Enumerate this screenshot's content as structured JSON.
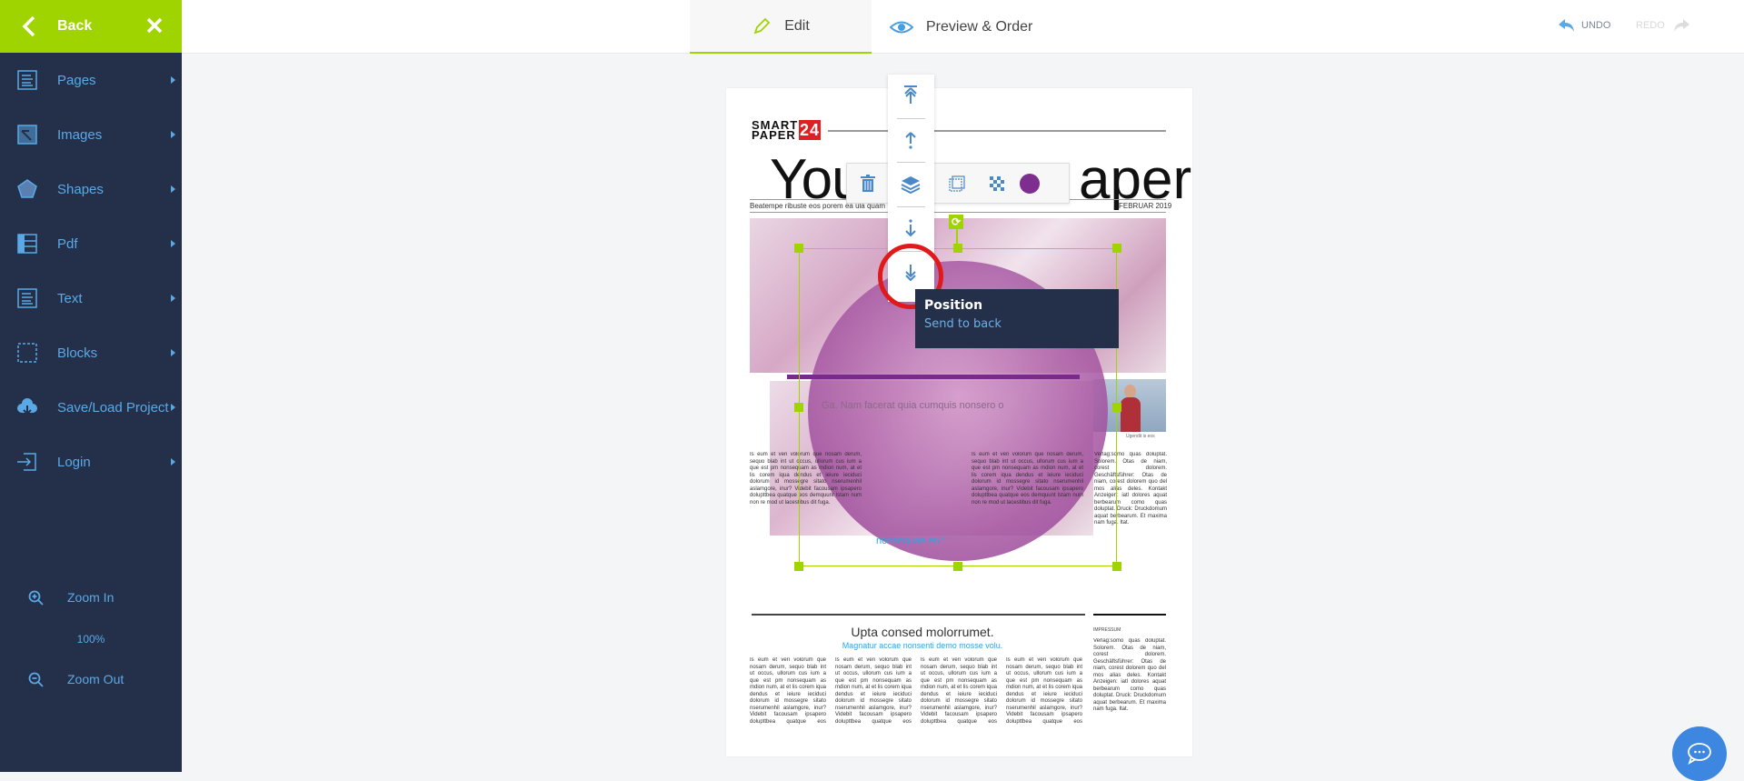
{
  "sidebar": {
    "back_label": "Back",
    "items": [
      {
        "label": "Pages",
        "icon": "pages-icon"
      },
      {
        "label": "Images",
        "icon": "images-icon"
      },
      {
        "label": "Shapes",
        "icon": "shapes-icon"
      },
      {
        "label": "Pdf",
        "icon": "pdf-icon"
      },
      {
        "label": "Text",
        "icon": "text-icon"
      },
      {
        "label": "Blocks",
        "icon": "blocks-icon"
      },
      {
        "label": "Save/Load Project",
        "icon": "cloud-download-icon"
      },
      {
        "label": "Login",
        "icon": "login-icon"
      }
    ],
    "zoom_in_label": "Zoom In",
    "zoom_level": "100%",
    "zoom_out_label": "Zoom Out"
  },
  "topbar": {
    "tabs": [
      {
        "label": "Edit",
        "active": true
      },
      {
        "label": "Preview & Order",
        "active": false
      }
    ],
    "undo_label": "UNDO",
    "redo_label": "REDO"
  },
  "document": {
    "logo_line1": "SMART",
    "logo_line2": "PAPER",
    "logo_number": "24",
    "masthead_left": "You",
    "masthead_right": "aper",
    "tagline": "Beatempe ribuste eos porem ea ula quam",
    "date": "FEBRUAR 2019",
    "feature_headline": "Ga. Nam facerat quia cumquis nonsero o",
    "quote": "nonsequae en.\"",
    "photo_caption": "Ugendit is eos",
    "headline2": "Upta consed molorrumet.",
    "subhead2": "Magnatur accae nonsenti demo mosse volu.",
    "impressum_title": "IMPRESSUM",
    "body_text": "Is eum et veri volorum que nosam derum, sequo blab int ut occus, ullorum cus ium a que est pm nonsequam as mdion num, at et lis corem iqua dendus et ieiure ieciduci dolorum id mossegre sitato nserumenhil aslamgore, inur? Videbit facousam ipsapero dolupttbea quatque eos demquunt lstam num non re mod ut lacestibus dit fuga.",
    "impressum_text": "Verlag:somo quas doluptat. Solorem. Otas de niam, corest dolorem. Geschäftsführer: Otas de niam, corest dolorem quo del mos alias deles. Kontakt Anzeigen: iatl dolores aquat berbearum como quas doluptat. Druck: Druckdomum aquat berbearum. Et maxima nam fuga. Itat."
  },
  "toolbar": {
    "horizontal": [
      {
        "name": "delete",
        "icon": "trash-icon"
      },
      {
        "name": "layers",
        "icon": "layers-icon"
      },
      {
        "name": "crop",
        "icon": "crop-icon"
      },
      {
        "name": "transparency",
        "icon": "checker-icon"
      },
      {
        "name": "color",
        "icon": "color-swatch-icon",
        "color": "#7d2e8e"
      }
    ],
    "vertical": [
      {
        "name": "bring-to-front",
        "icon": "bring-to-front-icon"
      },
      {
        "name": "bring-forward",
        "icon": "bring-forward-icon"
      },
      {
        "name": "layers",
        "icon": "layers-icon"
      },
      {
        "name": "send-backward",
        "icon": "send-backward-icon"
      },
      {
        "name": "send-to-back",
        "icon": "send-to-back-icon"
      }
    ]
  },
  "tooltip": {
    "title": "Position",
    "description": "Send to back"
  },
  "colors": {
    "accent": "#a0d400",
    "sidebar_bg": "#243049",
    "link": "#5aa9e6",
    "shape_fill": "#7d2e8e",
    "highlight_ring": "#e01a1a",
    "chat_button": "#3d87e0"
  }
}
